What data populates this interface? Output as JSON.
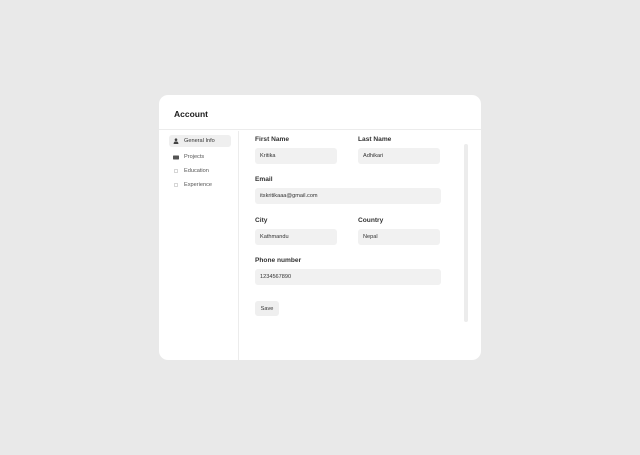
{
  "card": {
    "title": "Account"
  },
  "sidebar": {
    "items": [
      {
        "label": "General Info",
        "icon": "user-icon",
        "active": true
      },
      {
        "label": "Projects",
        "icon": "folder-icon",
        "active": false
      },
      {
        "label": "Education",
        "icon": "dot-icon",
        "active": false
      },
      {
        "label": "Experience",
        "icon": "dot-icon",
        "active": false
      }
    ]
  },
  "form": {
    "first_name": {
      "label": "First Name",
      "value": "Kritika"
    },
    "last_name": {
      "label": "Last Name",
      "value": "Adhikari"
    },
    "email": {
      "label": "Email",
      "value": "itskritikaaa@gmail.com"
    },
    "city": {
      "label": "City",
      "value": "Kathmandu"
    },
    "country": {
      "label": "Country",
      "value": "Nepal"
    },
    "phone": {
      "label": "Phone number",
      "value": "1234567890"
    },
    "save_label": "Save"
  },
  "colors": {
    "background": "#e9e9e9",
    "card": "#ffffff",
    "input": "#f1f1f1",
    "active_nav": "#efefef"
  }
}
